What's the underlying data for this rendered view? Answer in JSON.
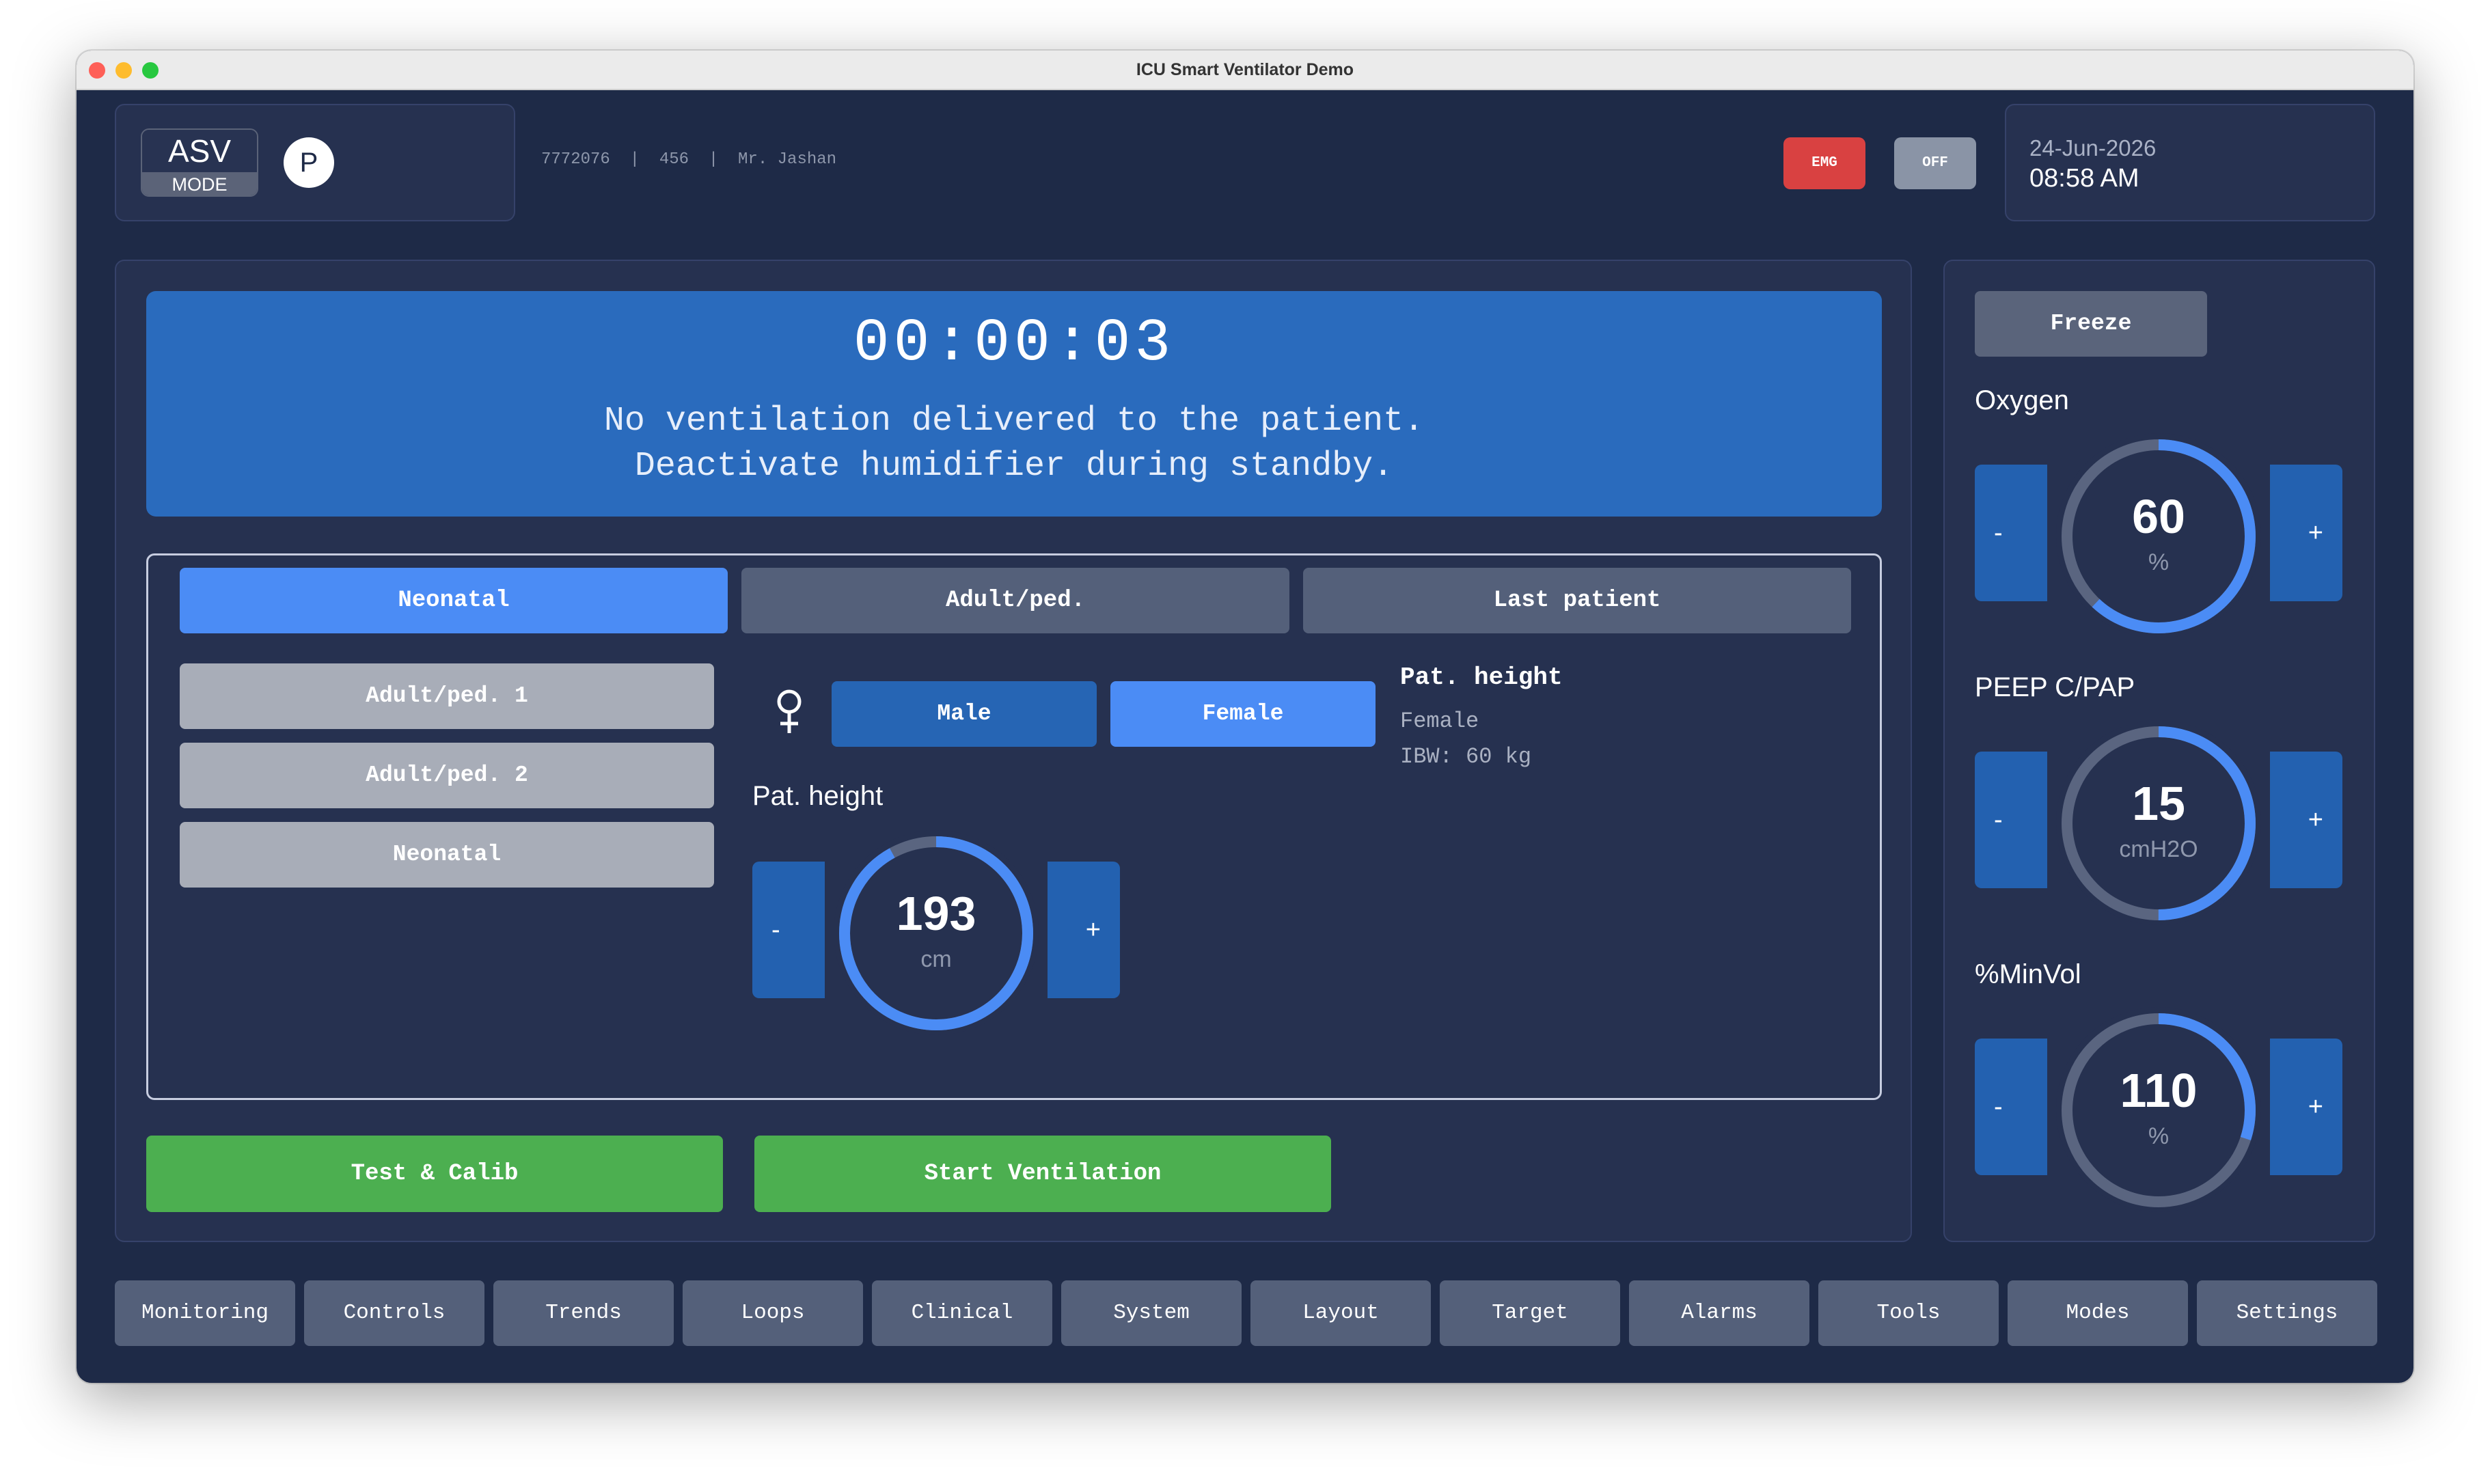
{
  "window": {
    "title": "ICU Smart Ventilator Demo"
  },
  "header": {
    "mode_name": "ASV",
    "mode_label": "MODE",
    "badge": "P",
    "patient_info": "7772076  |  456  |  Mr. Jashan",
    "emg_label": "EMG",
    "off_label": "OFF",
    "date": "24-Jun-2026",
    "time": "08:58 AM"
  },
  "status": {
    "timer": "00:00:03",
    "line1": "No ventilation delivered to the patient.",
    "line2": "Deactivate humidifier during standby."
  },
  "tabs": [
    {
      "label": "Neonatal",
      "active": true
    },
    {
      "label": "Adult/ped.",
      "active": false
    },
    {
      "label": "Last patient",
      "active": false
    }
  ],
  "presets": [
    "Adult/ped. 1",
    "Adult/ped. 2",
    "Neonatal"
  ],
  "gender": {
    "male_label": "Male",
    "female_label": "Female",
    "selected": "Female",
    "icon": "female-symbol-icon"
  },
  "height_control": {
    "label": "Pat. height",
    "value": "193",
    "unit": "cm",
    "fill": 0.92,
    "minus": "-",
    "plus": "+"
  },
  "summary": {
    "title": "Pat. height",
    "gender": "Female",
    "ibw": "IBW: 60 kg"
  },
  "actions": {
    "test_label": "Test & Calib",
    "start_label": "Start Ventilation"
  },
  "controls": {
    "freeze_label": "Freeze",
    "oxygen": {
      "label": "Oxygen",
      "value": "60",
      "unit": "%",
      "fill": 0.62,
      "minus": "-",
      "plus": "+"
    },
    "peep": {
      "label": "PEEP C/PAP",
      "value": "15",
      "unit": "cmH2O",
      "fill": 0.5,
      "minus": "-",
      "plus": "+"
    },
    "minvol": {
      "label": "%MinVol",
      "value": "110",
      "unit": "%",
      "fill": 0.3,
      "minus": "-",
      "plus": "+"
    }
  },
  "nav": [
    "Monitoring",
    "Controls",
    "Trends",
    "Loops",
    "Clinical",
    "System",
    "Layout",
    "Target",
    "Alarms",
    "Tools",
    "Modes",
    "Settings"
  ],
  "colors": {
    "accent": "#4b8cf5",
    "ring_track": "#5a6580",
    "start": "#4caf50",
    "emergency": "#d94141"
  }
}
